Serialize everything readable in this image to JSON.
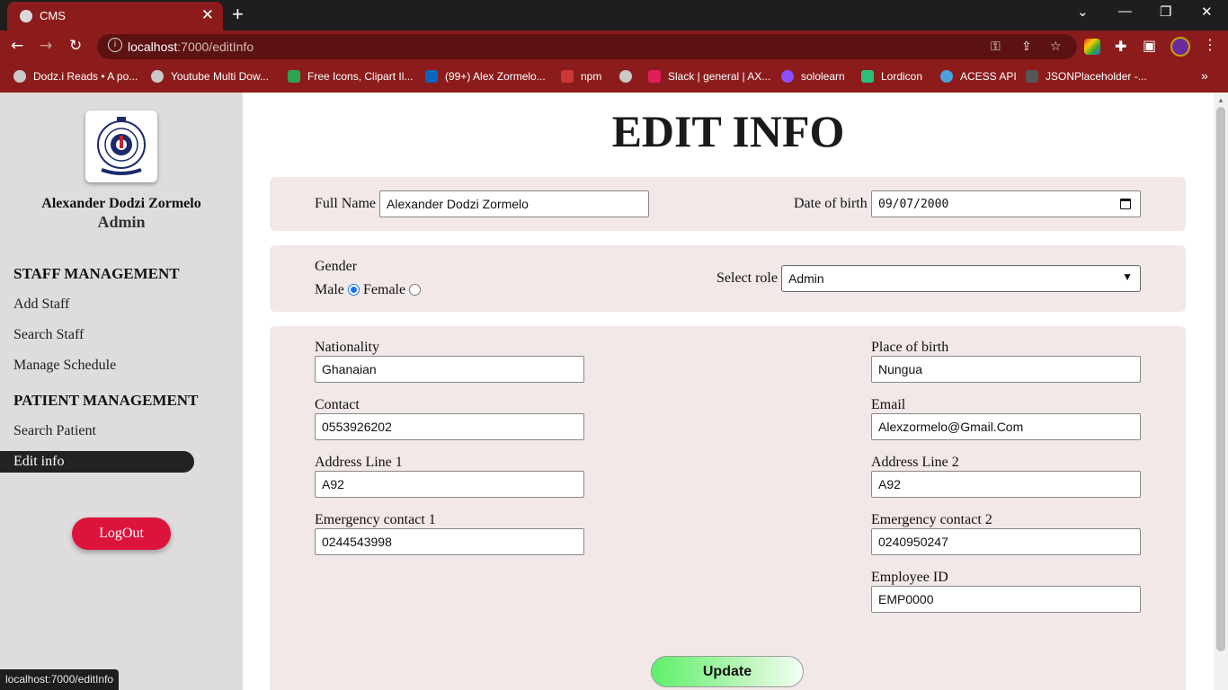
{
  "browser": {
    "tab_title": "CMS",
    "url_host": "localhost",
    "url_path": ":7000/editInfo",
    "status_url": "localhost:7000/editInfo",
    "bookmarks": [
      {
        "label": "Dodz.i Reads • A po...",
        "icon": "globe-icon",
        "color": "#c9c9c9"
      },
      {
        "label": "Youtube Multi Dow...",
        "icon": "globe-icon",
        "color": "#c9c9c9"
      },
      {
        "label": "Free Icons, Clipart Il...",
        "icon": "flaticon-icon",
        "color": "#2ea44f"
      },
      {
        "label": "(99+) Alex Zormelo...",
        "icon": "linkedin-icon",
        "color": "#0a66c2"
      },
      {
        "label": "npm",
        "icon": "npm-icon",
        "color": "#cb3837"
      },
      {
        "label": "",
        "icon": "globe-icon",
        "color": "#c9c9c9"
      },
      {
        "label": "Slack | general | AX...",
        "icon": "slack-icon",
        "color": "#e01e5a"
      },
      {
        "label": "sololearn",
        "icon": "sololearn-icon",
        "color": "#8a4fff"
      },
      {
        "label": "Lordicon",
        "icon": "lordicon-icon",
        "color": "#2bbf7a"
      },
      {
        "label": "ACESS API",
        "icon": "api-icon",
        "color": "#4aa3df"
      },
      {
        "label": "JSONPlaceholder -...",
        "icon": "json-icon",
        "color": "#555555"
      }
    ]
  },
  "sidebar": {
    "user_name": "Alexander Dodzi Zormelo",
    "user_role": "Admin",
    "staff_heading": "STAFF MANAGEMENT",
    "staff_items": [
      "Add Staff",
      "Search Staff",
      "Manage Schedule"
    ],
    "patient_heading": "PATIENT MANAGEMENT",
    "patient_items": [
      "Search Patient",
      "Edit info"
    ],
    "logout_label": "LogOut"
  },
  "page": {
    "title": "EDIT INFO",
    "full_name_label": "Full Name",
    "full_name_value": "Alexander Dodzi Zormelo",
    "dob_label": "Date of birth",
    "dob_value": "09/07/2000",
    "gender_label": "Gender",
    "gender_male": "Male",
    "gender_female": "Female",
    "gender_selected": "Male",
    "role_label": "Select role",
    "role_value": "Admin",
    "nationality_label": "Nationality",
    "nationality_value": "Ghanaian",
    "place_of_birth_label": "Place of birth",
    "place_of_birth_value": "Nungua",
    "contact_label": "Contact",
    "contact_value": "0553926202",
    "email_label": "Email",
    "email_value": "Alexzormelo@Gmail.Com",
    "address1_label": "Address Line 1",
    "address1_value": "A92",
    "address2_label": "Address Line 2",
    "address2_value": "A92",
    "emergency1_label": "Emergency contact 1",
    "emergency1_value": "0244543998",
    "emergency2_label": "Emergency contact 2",
    "emergency2_value": "0240950247",
    "employee_id_label": "Employee ID",
    "employee_id_value": "EMP0000",
    "update_label": "Update"
  },
  "colors": {
    "chrome_red": "#8c1c1c",
    "logout_red": "#dc143c",
    "panel_bg": "#f2e8e8",
    "update_green": "#5ef06a"
  }
}
